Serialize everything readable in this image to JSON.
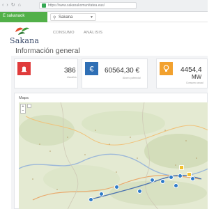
{
  "browser": {
    "nav_icons": [
      "‹",
      "›",
      "↻",
      "⌂"
    ],
    "url_text": "https://www.sakanakomunitatea.eus/"
  },
  "appbar": {
    "account_label": "E sakanaok",
    "selector_label": "Sakana"
  },
  "header": {
    "logo_text": "Sakana",
    "nav": [
      "CONSUMO",
      "ANÁLISIS"
    ]
  },
  "info": {
    "title": "Información general",
    "cards": [
      {
        "icon": "building-icon",
        "color": "#e03b3b",
        "value": "386",
        "sub": "Usuarios"
      },
      {
        "icon": "euro-icon",
        "color": "#2f6fb5",
        "value": "60564,30 €",
        "sub": "Ahorro potencial"
      },
      {
        "icon": "bulb-icon",
        "color": "#f2a12e",
        "value": "4454,4",
        "unit": "MW",
        "sub": "Consumo anual"
      }
    ]
  },
  "map": {
    "title": "Mapa",
    "zoom_in": "+",
    "zoom_out": "−"
  }
}
